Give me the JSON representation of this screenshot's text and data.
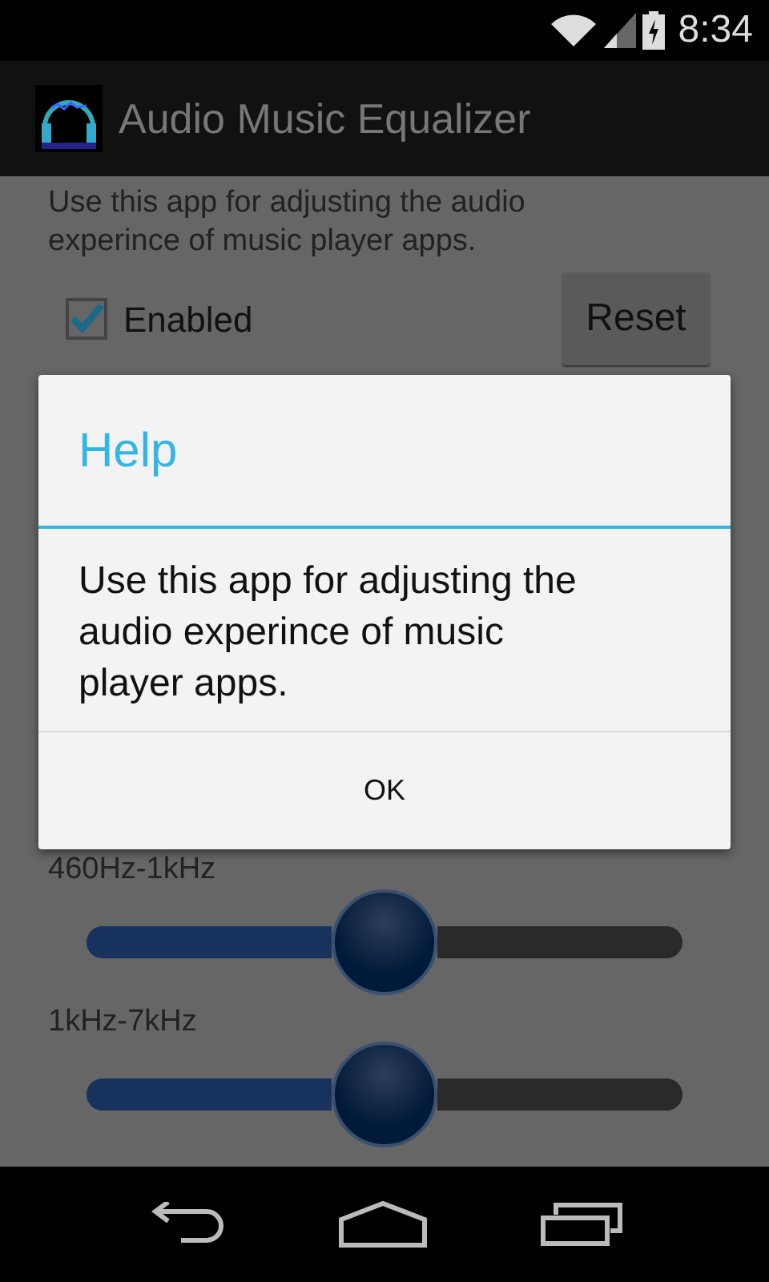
{
  "status_bar": {
    "time": "8:34"
  },
  "action_bar": {
    "title": "Audio Music Equalizer"
  },
  "description": "Use this app for adjusting the audio experince of music player apps.",
  "enabled": {
    "label": "Enabled",
    "checked": true
  },
  "reset_button": "Reset",
  "bands": [
    {
      "label": "460Hz-1kHz",
      "level": 0.5
    },
    {
      "label": "1kHz-7kHz",
      "level": 0.5
    }
  ],
  "dialog": {
    "title": "Help",
    "message": "Use this app for adjusting the audio experince of music player apps.",
    "button": "OK"
  }
}
